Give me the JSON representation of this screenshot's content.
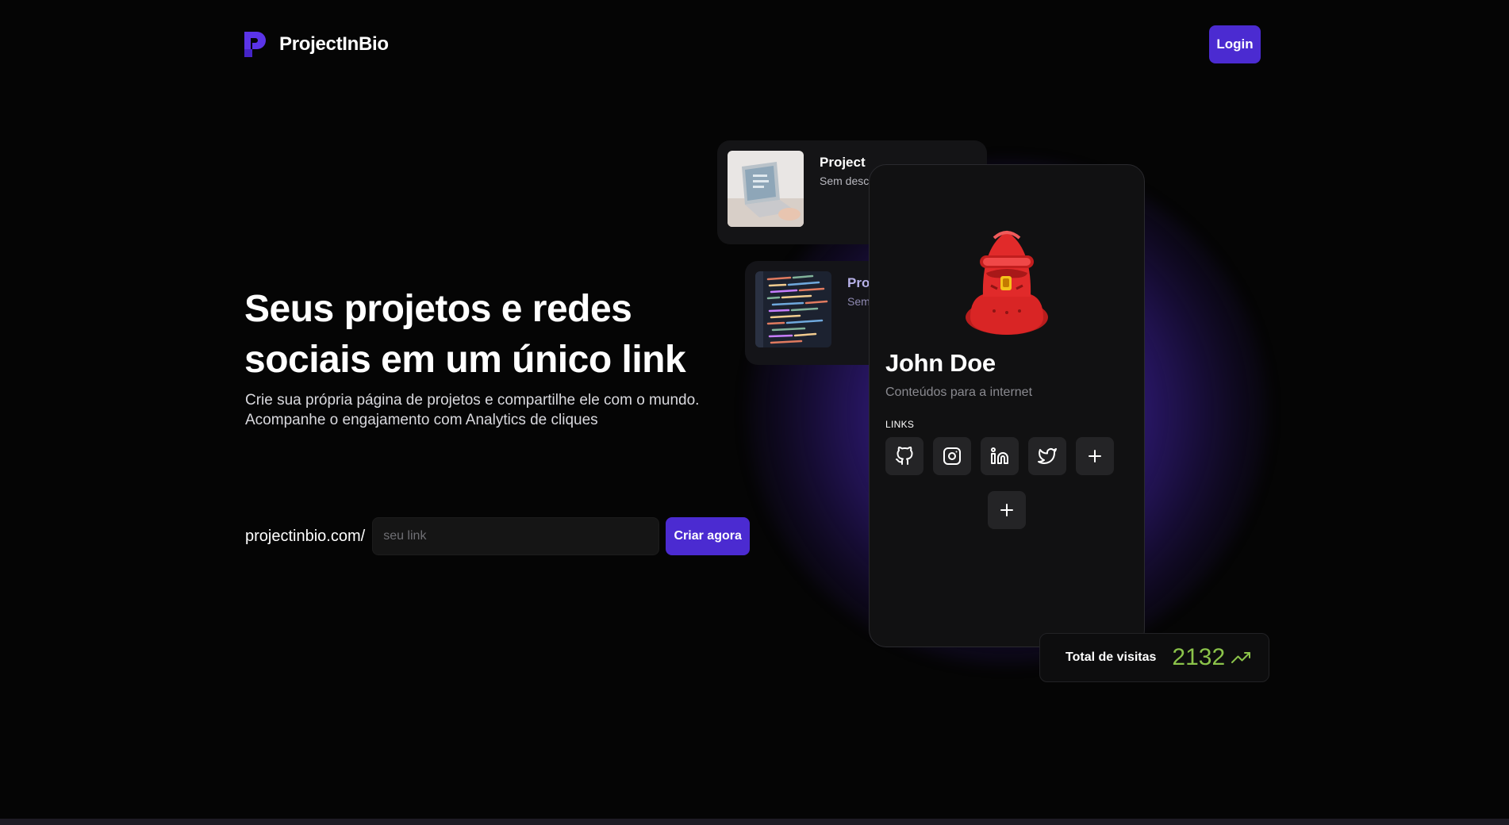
{
  "brand": {
    "name": "ProjectInBio"
  },
  "header": {
    "login_label": "Login"
  },
  "hero": {
    "title": "Seus projetos e redes sociais em um único link",
    "subtitle_line1": "Crie sua própria página de projetos e compartilhe ele com o mundo.",
    "subtitle_line2": "Acompanhe o engajamento com Analytics de cliques",
    "url_prefix": "projectinbio.com/",
    "input_placeholder": "seu link",
    "input_value": "",
    "cta_label": "Criar agora"
  },
  "projects": [
    {
      "title": "Project",
      "description": "Sem descrição"
    },
    {
      "title": "Project",
      "description": "Sem descrição"
    }
  ],
  "profile": {
    "name": "John Doe",
    "description": "Conteúdos para a internet",
    "links_label": "LINKS",
    "social_icons": [
      "github-icon",
      "instagram-icon",
      "linkedin-icon",
      "twitter-icon",
      "plus-icon"
    ]
  },
  "visits": {
    "label": "Total de visitas",
    "value": "2132",
    "trend_icon": "trending-up-icon"
  },
  "colors": {
    "accent": "#4b2bd1",
    "background": "#050505",
    "card": "#111112",
    "success": "#8bc34a"
  }
}
